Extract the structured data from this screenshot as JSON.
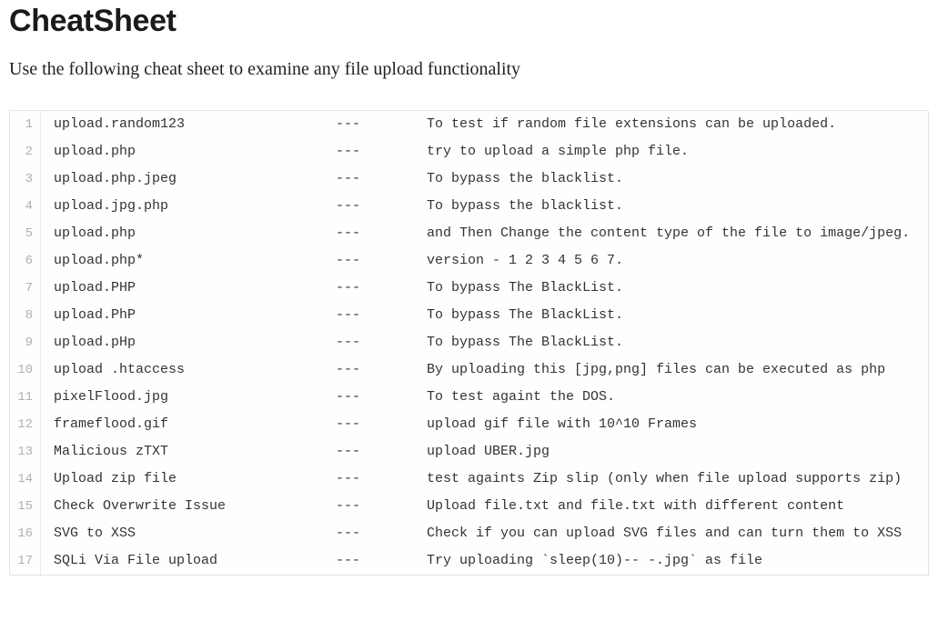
{
  "heading": "CheatSheet",
  "intro": "Use the following cheat sheet to examine any file upload functionality",
  "separator": "---",
  "rows": [
    {
      "n": 1,
      "left": "upload.random123",
      "desc": "To test if random file extensions can be uploaded."
    },
    {
      "n": 2,
      "left": "upload.php",
      "desc": "try to upload a simple php file."
    },
    {
      "n": 3,
      "left": "upload.php.jpeg",
      "desc": "To bypass the blacklist."
    },
    {
      "n": 4,
      "left": "upload.jpg.php",
      "desc": "To bypass the blacklist."
    },
    {
      "n": 5,
      "left": "upload.php",
      "desc": "and Then Change the content type of the file to image/jpeg."
    },
    {
      "n": 6,
      "left": "upload.php*",
      "desc": "version - 1 2 3 4 5 6 7."
    },
    {
      "n": 7,
      "left": "upload.PHP",
      "desc": "To bypass The BlackList."
    },
    {
      "n": 8,
      "left": "upload.PhP",
      "desc": "To bypass The BlackList."
    },
    {
      "n": 9,
      "left": "upload.pHp",
      "desc": "To bypass The BlackList."
    },
    {
      "n": 10,
      "left": "upload .htaccess",
      "desc": "By uploading this [jpg,png] files can be executed as php"
    },
    {
      "n": 11,
      "left": "pixelFlood.jpg",
      "desc": "To test againt the DOS."
    },
    {
      "n": 12,
      "left": "frameflood.gif",
      "desc": "upload gif file with 10^10 Frames"
    },
    {
      "n": 13,
      "left": "Malicious zTXT",
      "desc": "upload UBER.jpg"
    },
    {
      "n": 14,
      "left": "Upload zip file",
      "desc": "test againts Zip slip (only when file upload supports zip)"
    },
    {
      "n": 15,
      "left": "Check Overwrite Issue",
      "desc": "Upload file.txt and file.txt with different content"
    },
    {
      "n": 16,
      "left": "SVG to XSS",
      "desc": "Check if you can upload SVG files and can turn them to XSS"
    },
    {
      "n": 17,
      "left": "SQLi Via File upload",
      "desc": "Try uploading `sleep(10)-- -.jpg` as file"
    }
  ]
}
